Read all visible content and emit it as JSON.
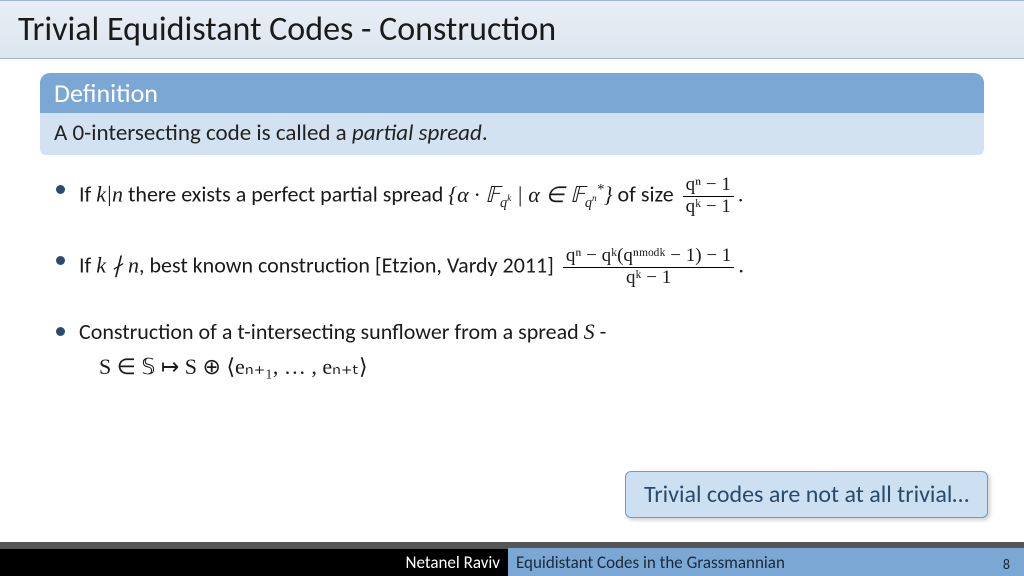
{
  "title": "Trivial Equidistant Codes - Construction",
  "definition": {
    "header": "Definition",
    "body_prefix": "A 0-intersecting code is called a ",
    "body_ital": "partial spread",
    "body_suffix": "."
  },
  "bullets": {
    "b1": {
      "t1": "If ",
      "m1": "k|n",
      "t2": " there exists a perfect partial spread ",
      "m2": "{α · 𝔽",
      "m2a": "q",
      "m2b": "k",
      "m2c": " | α ∈ 𝔽",
      "m2d": "q",
      "m2e": "n",
      "m2f": "*",
      "m2g": "}",
      "t3": " of size ",
      "frac_num": "qⁿ − 1",
      "frac_den": "qᵏ − 1",
      "t4": "."
    },
    "b2": {
      "t1": "If ",
      "m1": "k ∤ n",
      "t2": ", best known construction [Etzion, Vardy 2011]  ",
      "frac_num": "qⁿ − qᵏ(qⁿᵐᵒᵈᵏ − 1) − 1",
      "frac_den": "qᵏ − 1",
      "t3": "."
    },
    "b3": {
      "t1": "Construction of a t-intersecting sunflower from a spread ",
      "m1": "S",
      "t2": " -",
      "sub": "S ∈ 𝕊 ↦ S ⊕ ⟨eₙ₊₁, … , eₙ₊ₜ⟩"
    }
  },
  "callout": "Trivial codes are not at all trivial…",
  "footer": {
    "author": "Netanel Raviv",
    "talk": "Equidistant Codes in the Grassmannian",
    "page": "8"
  }
}
